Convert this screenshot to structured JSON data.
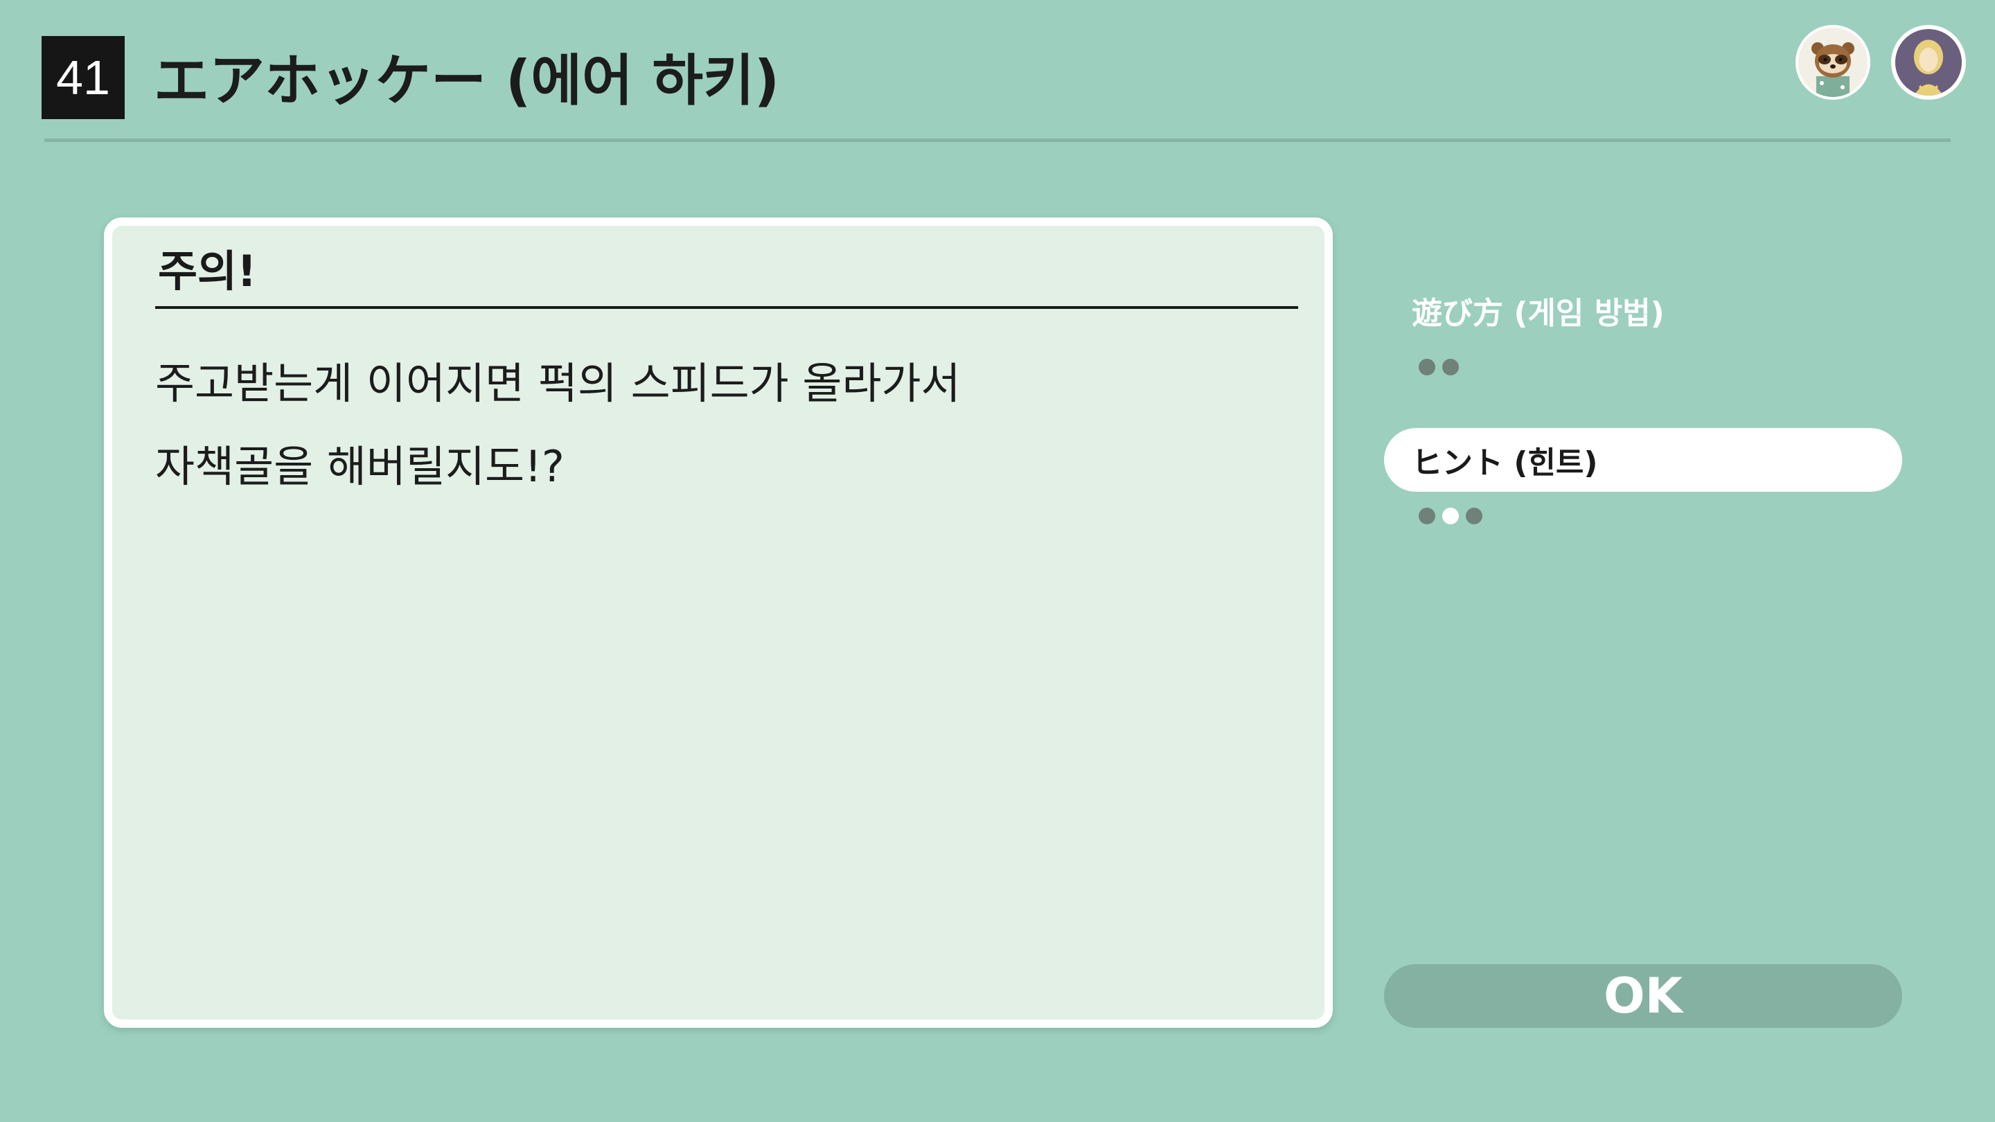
{
  "header": {
    "number": "41",
    "title": "エアホッケー (에어 하키)"
  },
  "avatars": [
    {
      "icon": "tanuki-villager-avatar-icon"
    },
    {
      "icon": "blonde-user-avatar-icon"
    }
  ],
  "card": {
    "heading": "주의!",
    "lines": [
      "주고받는게 이어지면 퍽의 스피드가 올라가서",
      "자책골을 해버릴지도!?"
    ]
  },
  "menu": {
    "items": [
      {
        "label": "遊び方 (게임 방법)",
        "pages": 2,
        "active_page": 0,
        "selected": false
      },
      {
        "label": "ヒント (힌트)",
        "pages": 3,
        "active_page": 2,
        "selected": true
      }
    ]
  },
  "ok_button": {
    "label": "OK"
  },
  "colors": {
    "background": "#9ccfbe",
    "card": "#e2f0e6",
    "selected_item": "#ffffff",
    "ok_button": "#84b1a2"
  }
}
